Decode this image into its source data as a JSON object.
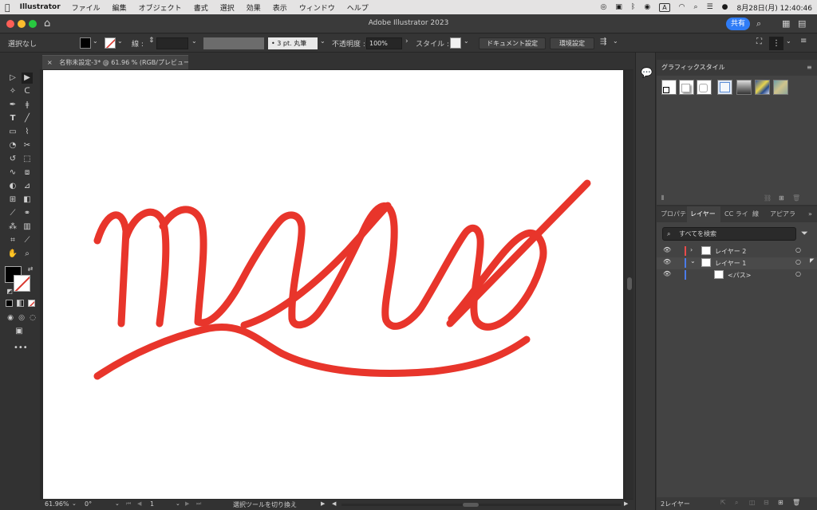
{
  "menubar": {
    "apple_icon": "apple-icon",
    "app_name": "Illustrator",
    "items": [
      "ファイル",
      "編集",
      "オブジェクト",
      "書式",
      "選択",
      "効果",
      "表示",
      "ウィンドウ",
      "ヘルプ"
    ],
    "input_badge": "A",
    "date_time": "8月28日(月) 12:40:46"
  },
  "window": {
    "title": "Adobe Illustrator 2023",
    "share_label": "共有"
  },
  "control_bar": {
    "selection_status": "選択なし",
    "stroke_label": "線 :",
    "brush_label": "3 pt. 丸筆",
    "opacity_label": "不透明度 :",
    "opacity_value": "100%",
    "style_label": "スタイル :",
    "document_settings": "ドキュメント設定",
    "preferences": "環境設定"
  },
  "document_tab": {
    "close": "×",
    "title": "名称未設定-3* @ 61.96 % (RGB/プレビュー)"
  },
  "artwork": {
    "stroke_color": "#e8352b",
    "background": "#ffffff"
  },
  "statusbar": {
    "zoom": "61.96%",
    "rotation": "0°",
    "artboard_number": "1",
    "tool_status": "選択ツールを切り換え"
  },
  "graphic_styles_panel": {
    "title": "グラフィックスタイル"
  },
  "layers_panel": {
    "tabs": [
      "プロパテ",
      "レイヤー",
      "CC ライ",
      "線",
      "アピアラ"
    ],
    "search_placeholder": "すべてを検索",
    "rows": [
      {
        "name": "レイヤー 2",
        "color": "#e84b4b",
        "expanded": false
      },
      {
        "name": "レイヤー 1",
        "color": "#4b7be8",
        "expanded": true
      },
      {
        "name": "<パス>",
        "color": "#4b7be8"
      }
    ],
    "footer": "2レイヤー"
  },
  "colors": {
    "accent": "#2f7cf6",
    "fill": "#000000",
    "stroke_none": "#d9382f"
  }
}
